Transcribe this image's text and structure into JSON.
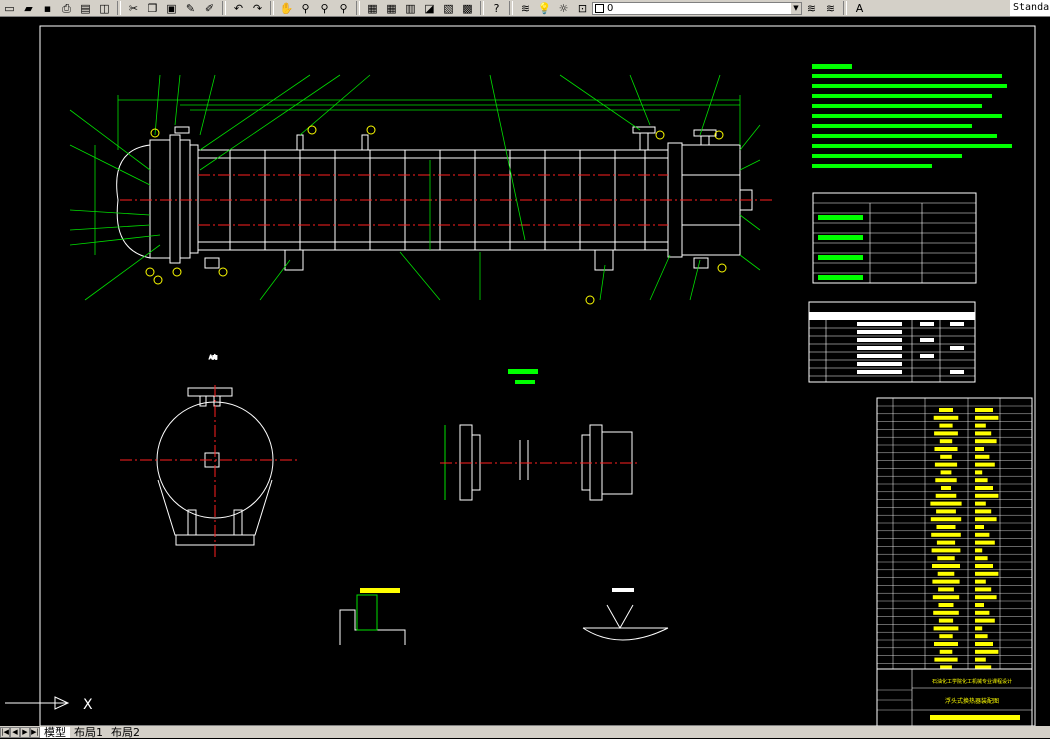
{
  "toolbar": {
    "layer_value": "0",
    "text_style_value": "Standard",
    "buttons": [
      "new-icon",
      "open-icon",
      "save-icon",
      "print-icon",
      "preview-icon",
      "publish-icon",
      "cut-icon",
      "copy-icon",
      "paste-icon",
      "match-properties-icon",
      "undo-icon",
      "redo-icon",
      "pan-icon",
      "zoom-realtime-icon",
      "zoom-window-icon",
      "zoom-previous-icon",
      "properties-icon",
      "design-center-icon",
      "tool-palettes-icon",
      "sheet-set-icon",
      "markup-icon",
      "calculator-icon",
      "help-icon"
    ]
  },
  "tabs": {
    "model": "模型",
    "layout1": "布局1",
    "layout2": "布局2"
  },
  "drawing": {
    "ucs_x_label": "X",
    "title_block_row1": "石油化工学院化工机械专业课程设计",
    "title_block_row2": "浮头式换热器装配图"
  },
  "colors": {
    "outline": "#ffffff",
    "centerline": "#ff2020",
    "dimension": "#00e000",
    "notes": "#00ff00",
    "table_text": "#ffff00",
    "title_text": "#ffff00"
  }
}
